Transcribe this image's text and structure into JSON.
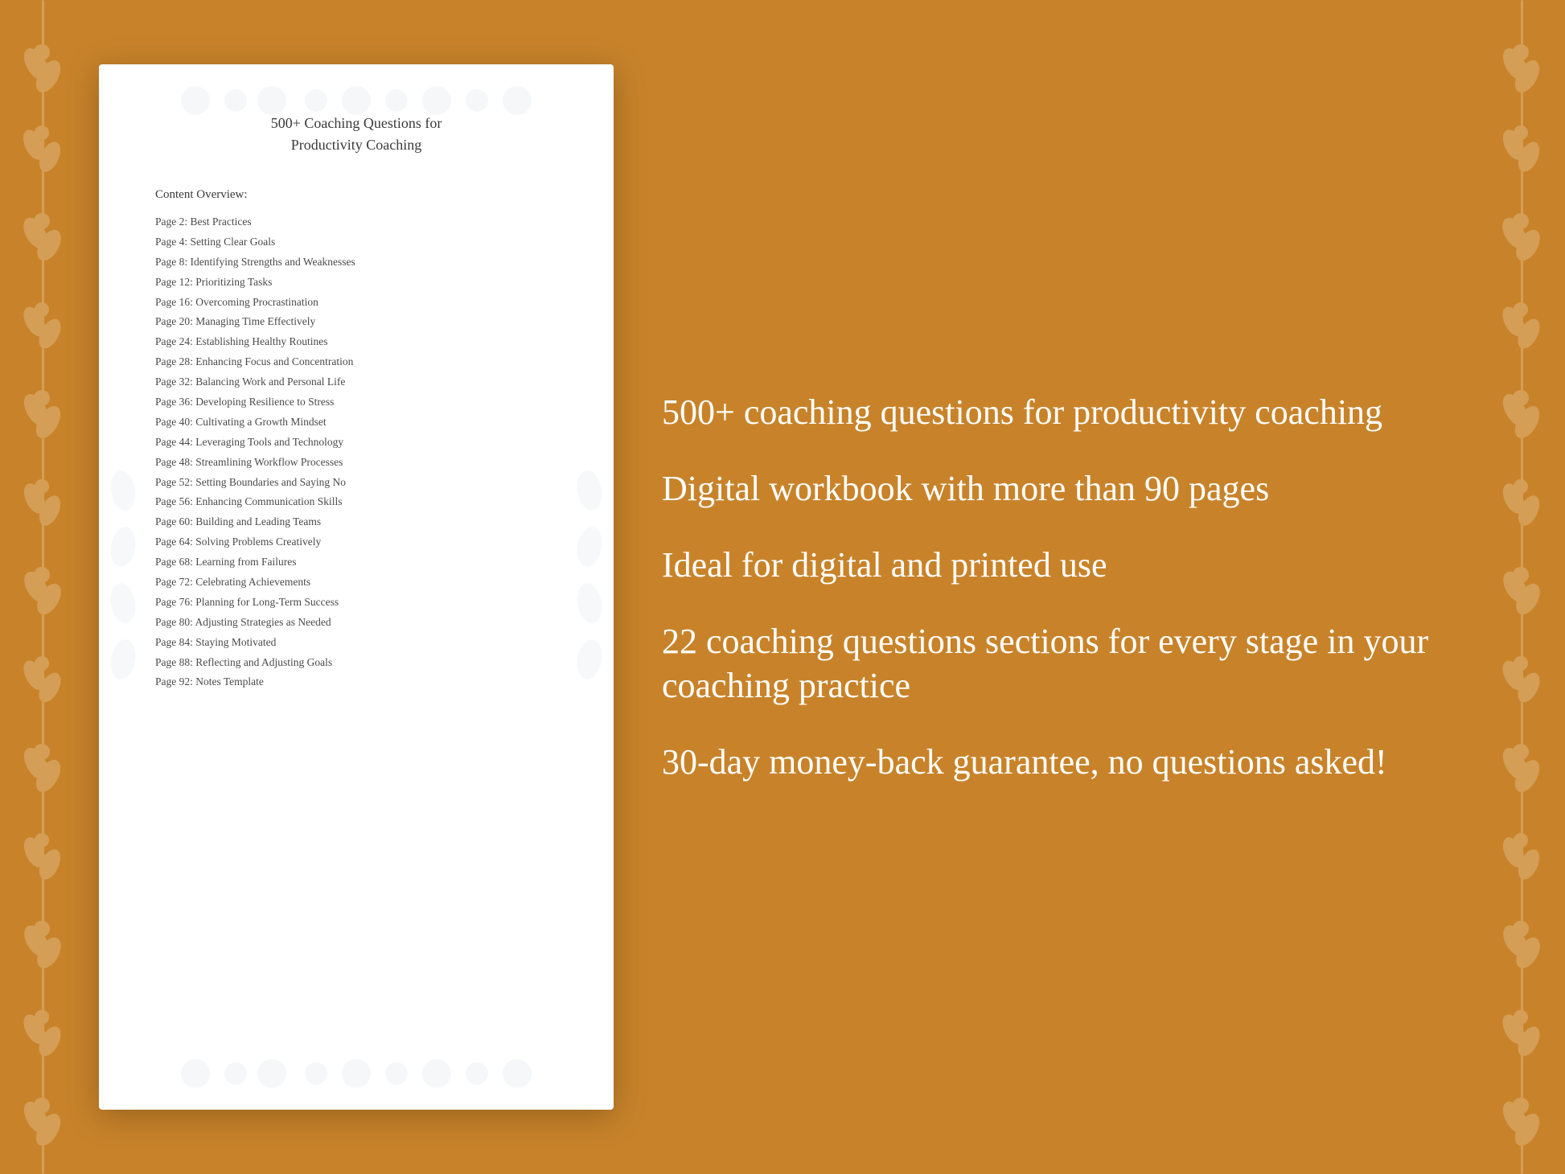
{
  "background": {
    "color": "#C8832A"
  },
  "document": {
    "title_line1": "500+ Coaching Questions for",
    "title_line2": "Productivity Coaching",
    "content_overview_label": "Content Overview:",
    "toc_items": [
      {
        "page": "Page  2:",
        "topic": "Best Practices"
      },
      {
        "page": "Page  4:",
        "topic": "Setting Clear Goals"
      },
      {
        "page": "Page  8:",
        "topic": "Identifying Strengths and Weaknesses"
      },
      {
        "page": "Page 12:",
        "topic": "Prioritizing Tasks"
      },
      {
        "page": "Page 16:",
        "topic": "Overcoming Procrastination"
      },
      {
        "page": "Page 20:",
        "topic": "Managing Time Effectively"
      },
      {
        "page": "Page 24:",
        "topic": "Establishing Healthy Routines"
      },
      {
        "page": "Page 28:",
        "topic": "Enhancing Focus and Concentration"
      },
      {
        "page": "Page 32:",
        "topic": "Balancing Work and Personal Life"
      },
      {
        "page": "Page 36:",
        "topic": "Developing Resilience to Stress"
      },
      {
        "page": "Page 40:",
        "topic": "Cultivating a Growth Mindset"
      },
      {
        "page": "Page 44:",
        "topic": "Leveraging Tools and Technology"
      },
      {
        "page": "Page 48:",
        "topic": "Streamlining Workflow Processes"
      },
      {
        "page": "Page 52:",
        "topic": "Setting Boundaries and Saying No"
      },
      {
        "page": "Page 56:",
        "topic": "Enhancing Communication Skills"
      },
      {
        "page": "Page 60:",
        "topic": "Building and Leading Teams"
      },
      {
        "page": "Page 64:",
        "topic": "Solving Problems Creatively"
      },
      {
        "page": "Page 68:",
        "topic": "Learning from Failures"
      },
      {
        "page": "Page 72:",
        "topic": "Celebrating Achievements"
      },
      {
        "page": "Page 76:",
        "topic": "Planning for Long-Term Success"
      },
      {
        "page": "Page 80:",
        "topic": "Adjusting Strategies as Needed"
      },
      {
        "page": "Page 84:",
        "topic": "Staying Motivated"
      },
      {
        "page": "Page 88:",
        "topic": "Reflecting and Adjusting Goals"
      },
      {
        "page": "Page 92:",
        "topic": "Notes Template"
      }
    ]
  },
  "features": [
    {
      "id": "feature-1",
      "text": "500+ coaching questions for productivity coaching"
    },
    {
      "id": "feature-2",
      "text": "Digital workbook with more than 90 pages"
    },
    {
      "id": "feature-3",
      "text": "Ideal for digital and printed use"
    },
    {
      "id": "feature-4",
      "text": "22 coaching questions sections for every stage in your coaching practice"
    },
    {
      "id": "feature-5",
      "text": "30-day money-back guarantee, no questions asked!"
    }
  ]
}
